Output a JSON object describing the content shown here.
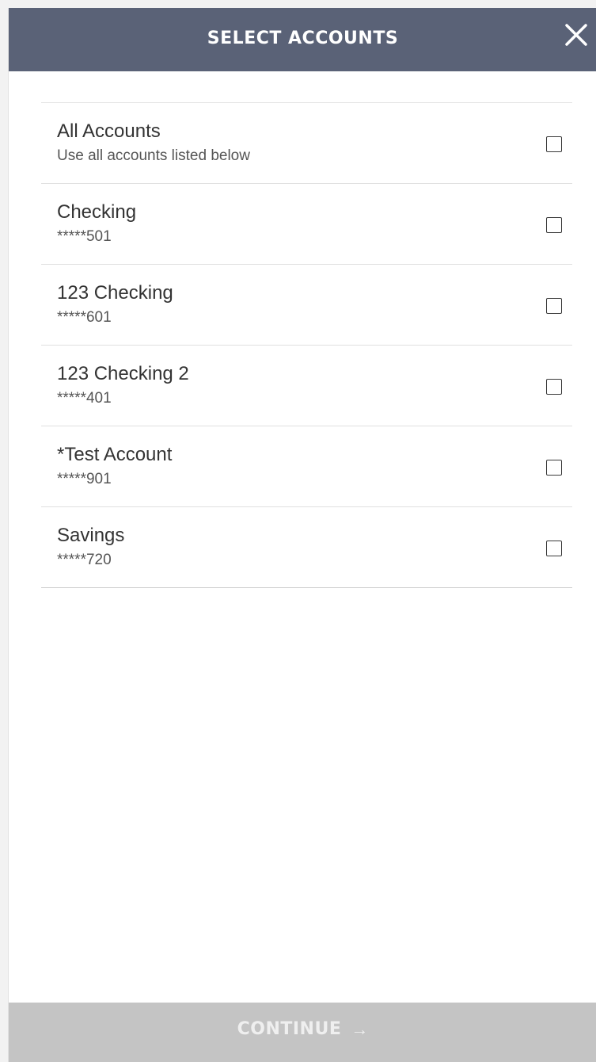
{
  "header": {
    "title": "SELECT ACCOUNTS",
    "close_icon": "close-icon"
  },
  "accounts": [
    {
      "name": "All Accounts",
      "detail": "Use all accounts listed below",
      "checked": false
    },
    {
      "name": "Checking",
      "detail": "*****501",
      "checked": false
    },
    {
      "name": "123 Checking",
      "detail": "*****601",
      "checked": false
    },
    {
      "name": "123 Checking 2",
      "detail": "*****401",
      "checked": false
    },
    {
      "name": "*Test Account",
      "detail": "*****901",
      "checked": false
    },
    {
      "name": "Savings",
      "detail": "*****720",
      "checked": false
    }
  ],
  "footer": {
    "continue_label": "CONTINUE",
    "arrow_icon": "arrow-right-icon",
    "arrow_glyph": "→"
  },
  "colors": {
    "header_bg": "#5a6277",
    "footer_bg_disabled": "#c4c4c4",
    "text_primary": "#333333"
  }
}
